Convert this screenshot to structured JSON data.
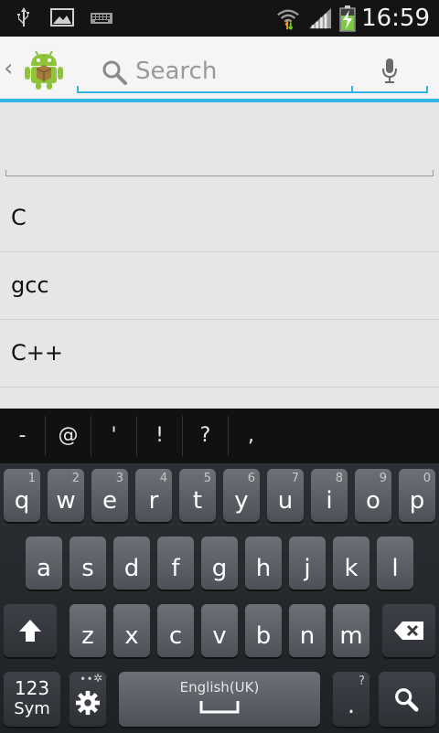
{
  "status_bar": {
    "time": "16:59",
    "icons": [
      "usb-icon",
      "image-icon",
      "keyboard-icon",
      "wifi-icon",
      "signal-icon",
      "battery-charging-icon"
    ]
  },
  "action_bar": {
    "back_icon": "chevron-left-icon",
    "app_icon": "android-app-icon",
    "search_placeholder": "Search",
    "search_value": "",
    "mic_icon": "microphone-icon",
    "accent_color": "#33b5e5"
  },
  "list": {
    "items": [
      "C",
      "gcc",
      "C++"
    ]
  },
  "keyboard": {
    "suggestions": [
      "-",
      "@",
      "'",
      "!",
      "?",
      ","
    ],
    "row1": [
      {
        "key": "q",
        "sub": "1"
      },
      {
        "key": "w",
        "sub": "2"
      },
      {
        "key": "e",
        "sub": "3"
      },
      {
        "key": "r",
        "sub": "4"
      },
      {
        "key": "t",
        "sub": "5"
      },
      {
        "key": "y",
        "sub": "6"
      },
      {
        "key": "u",
        "sub": "7"
      },
      {
        "key": "i",
        "sub": "8"
      },
      {
        "key": "o",
        "sub": "9"
      },
      {
        "key": "p",
        "sub": "0"
      }
    ],
    "row2": [
      "a",
      "s",
      "d",
      "f",
      "g",
      "h",
      "j",
      "k",
      "l"
    ],
    "row3": [
      "z",
      "x",
      "c",
      "v",
      "b",
      "n",
      "m"
    ],
    "sym_label_top": "123",
    "sym_label_bottom": "Sym",
    "space_label": "English(UK)",
    "period_label": ".",
    "period_sub": "?",
    "shift_icon": "shift-arrow-icon",
    "backspace_icon": "backspace-icon",
    "settings_icon": "gear-icon",
    "search_key_icon": "search-icon"
  }
}
